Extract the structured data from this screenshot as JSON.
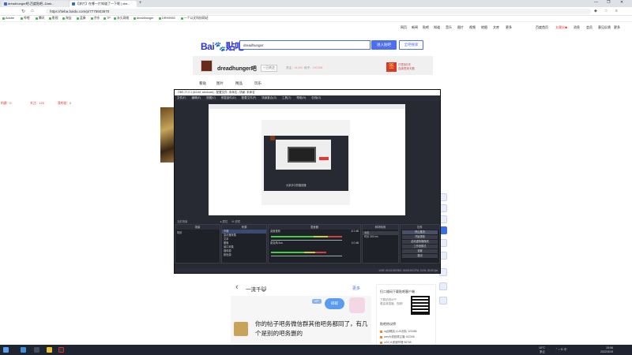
{
  "browser": {
    "tabs": [
      {
        "label": "dreadhunger吧-百度贴吧--Dark..."
      },
      {
        "label": "【求片】在哪一片知道了一下呢 | dre..."
      }
    ],
    "new_tab": "+",
    "window_controls": [
      "—",
      "❐",
      "✕"
    ],
    "url": "https://tieba.baidu.com/p/7775923670",
    "bookmarks": [
      "Adobe",
      "哔哩",
      "腾讯",
      "影视",
      "淘宝",
      "蓝奏",
      "京东",
      "TP",
      "永久网络",
      "dreadhunger",
      "DRH9953",
      "一个以文科技网站"
    ]
  },
  "baidu": {
    "top_links": [
      "网页",
      "新闻",
      "贴吧",
      "知道",
      "音乐",
      "图片",
      "视频",
      "地图",
      "文库",
      "更多"
    ],
    "right_links": [
      "百度首页",
      "五厘尖◆",
      "消息",
      "会员",
      "意见反馈",
      "更多"
    ],
    "search_value": "dreadhunger",
    "enter_button": "进入贴吧",
    "search_button": "全吧搜索",
    "bar_name": "dreadhunger吧",
    "follow": "+ 已关注",
    "stats_label1": "关注：",
    "stats_value1": "14,000",
    "stats_label2": "帖子：",
    "stats_value2": "190,298",
    "sign_icon": "签",
    "sign_line1": "已签到2天",
    "sign_line2": "连续签到天数",
    "tabs": [
      "看贴",
      "图片",
      "精品",
      "玩乐"
    ],
    "left_stats": [
      "构建：0",
      "关注：125",
      "我的贴：0"
    ]
  },
  "post": {
    "back": "‹",
    "title": "一流千😺",
    "more": "更多",
    "mini_button": "VIP",
    "bubble": "碎碎",
    "message": "你的帖子吧务微信群其他吧务都同了，有几个是别的吧务删的"
  },
  "right_panel": {
    "title": "扫二维码下载贴吧客户端",
    "desc1": "下载贴吧APP",
    "desc2": "看高清直播、视频！",
    "section": "贴吧热议榜",
    "items": [
      "ug战略加入UG战队",
      "wes大佬回顾主播",
      "UDC大佬被哔哩"
    ],
    "item_values": [
      "123456",
      "102345",
      "98765"
    ]
  },
  "obs": {
    "title": "OBS 27.2.1 (64-bit, windows) - 配置文件: 未命名 - 场景: 未命名",
    "menu": [
      "文件(F)",
      "编辑(E)",
      "视图(V)",
      "停靠部件(D)",
      "配置文件(P)",
      "场景集合(S)",
      "工具(T)",
      "帮助(H)",
      "在线(O)"
    ],
    "preview_caption": "大家手中的播放器",
    "controls_bar": [
      "● 属性",
      "⚙ 滤镜"
    ],
    "scene_label": "当前场景",
    "docks": {
      "scenes": {
        "title": "场景",
        "items": [
          "场景"
        ]
      },
      "sources": {
        "title": "来源",
        "items": [
          "不错",
          "显示器采集",
          "文本",
          "图像",
          "窗口采集",
          "媒体源",
          "颜色源",
          "显示器采集",
          "窗口采集"
        ]
      },
      "mixer": {
        "title": "混音器",
        "tracks": [
          {
            "name": "桌面音频",
            "db": "-5.1 dB"
          },
          {
            "name": "麦克风/Aux",
            "db": "0.0 dB"
          }
        ]
      },
      "transitions": {
        "title": "转场特效",
        "value": "淡出",
        "duration_label": "时长",
        "duration": "300 ms"
      },
      "controls": {
        "title": "控件",
        "buttons": [
          "停止推流",
          "开始录制",
          "启动虚拟摄像机",
          "工作室模式",
          "设置",
          "退出"
        ]
      }
    },
    "status": "LIVE: 00:12:05   REC: 00:00:00   CPU: 3.2%, 30.00 fps"
  },
  "taskbar": {
    "weather": "10°C",
    "weather2": "多云",
    "time": "15:06",
    "date": "2022/3/19"
  },
  "colors": {
    "accent": "#4e6ef2",
    "obs_bg": "#272a33",
    "taskbar": "#1e2530"
  }
}
